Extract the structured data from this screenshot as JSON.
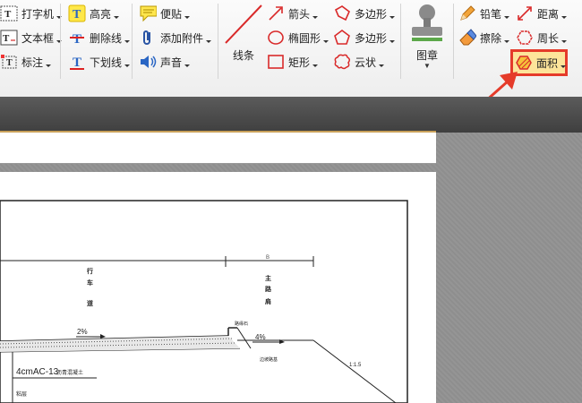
{
  "toolbar": {
    "text_tools": {
      "typewriter": "打字机",
      "textbox": "文本框",
      "callout": "标注"
    },
    "markup": {
      "highlight": "高亮",
      "strikeout": "删除线",
      "underline": "下划线"
    },
    "attach": {
      "note": "便贴",
      "attachment": "添加附件",
      "sound": "声音"
    },
    "lines": "线条",
    "shapes": {
      "arrow": "箭头",
      "oval": "椭圆形",
      "rectangle": "矩形",
      "polygon": "多边形",
      "polyline": "多边形",
      "cloud": "云状"
    },
    "stamp": "图章",
    "drawing": {
      "pencil": "铅笔",
      "eraser": "擦除"
    },
    "measure": {
      "distance": "距离",
      "perimeter": "周长",
      "area": "面积"
    }
  },
  "drawing_labels": {
    "lane_top": "行",
    "lane_mid": "车",
    "lane_bot": "道",
    "main_top": "主",
    "main_mid": "路",
    "main_bot": "肩",
    "dim_top": "B",
    "slope_left": "2%",
    "slope_right": "4%",
    "curb": "路缘石",
    "layer1": "4cmAC-13",
    "layer1_suffix": "沥青混凝土",
    "layer2": "粘层",
    "edge": "边坡路基",
    "ratio": "1:1.5"
  },
  "colors": {
    "accent": "#e53b2a",
    "highlight_fill": "#fde49a"
  }
}
